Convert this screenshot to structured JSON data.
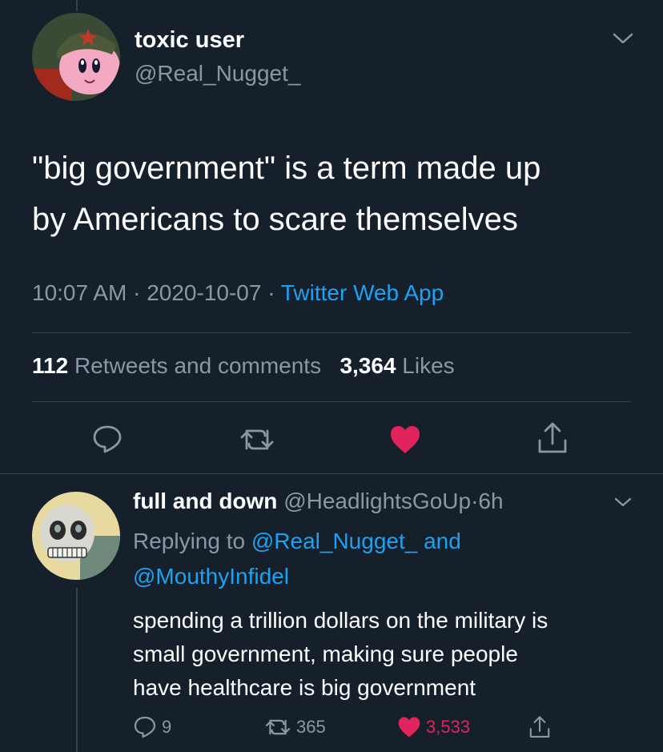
{
  "main_tweet": {
    "display_name": "toxic user",
    "handle": "@Real_Nugget_",
    "text_line1": "\"big government\" is a term made up",
    "text_line2": "by Americans to scare themselves",
    "time": "10:07 AM",
    "date": "2020-10-07",
    "separator": "·",
    "source": "Twitter Web App",
    "retweets_count": "112",
    "retweets_label": "Retweets and comments",
    "likes_count": "3,364",
    "likes_label": "Likes",
    "liked": true
  },
  "reply_tweet": {
    "display_name": "full and down",
    "handle": "@HeadlightsGoUp",
    "separator": "·",
    "time": "6h",
    "replying_prefix": "Replying to",
    "replying_user1": "@Real_Nugget_",
    "replying_and": "and",
    "replying_user2": "@MouthyInfidel",
    "text_line1": "spending a trillion dollars on the military is",
    "text_line2": "small government, making sure people",
    "text_line3": "have healthcare is big government",
    "reply_count": "9",
    "retweet_count": "365",
    "like_count": "3,533",
    "liked": true
  },
  "colors": {
    "background": "#15202b",
    "link": "#1da1f2",
    "like": "#e0245e",
    "secondary_text": "#8899a6",
    "divider": "#38444d"
  },
  "icons": [
    "chevron-down-icon",
    "reply-icon",
    "retweet-icon",
    "heart-icon",
    "share-icon"
  ]
}
